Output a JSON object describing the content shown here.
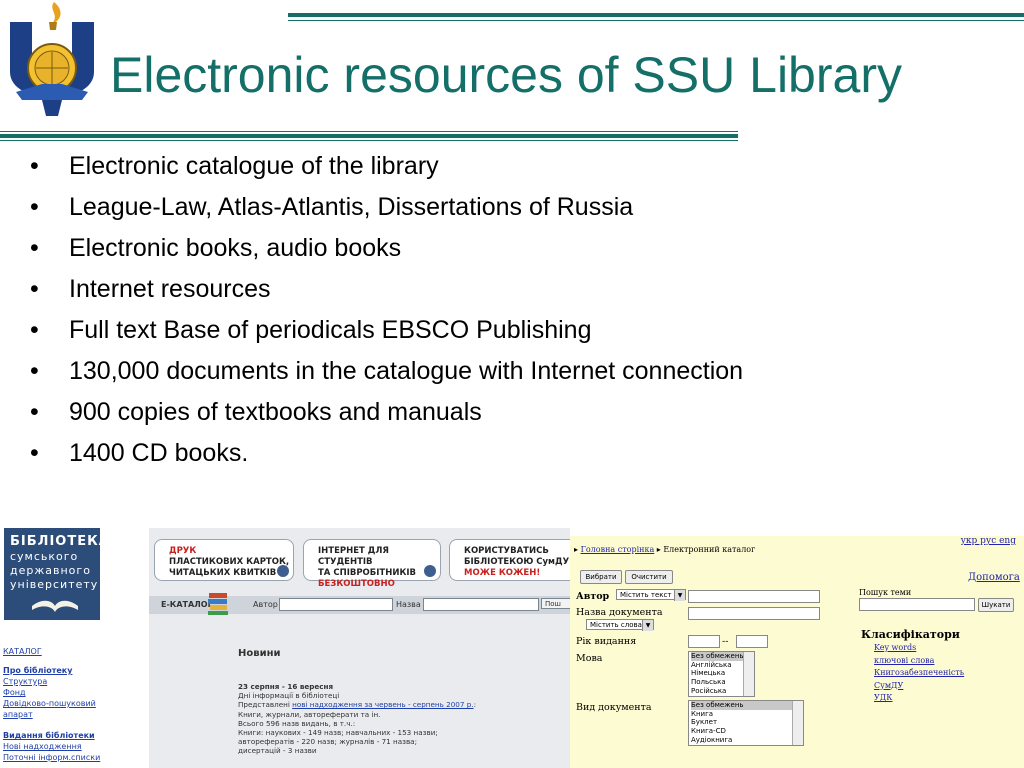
{
  "slide": {
    "title": "Electronic resources of SSU Library",
    "logo_icon": "university-torch-crest-logo",
    "bullets": [
      "Electronic catalogue of the library",
      "League-Law, Atlas-Atlantis, Dissertations of Russia",
      "Electronic books, audio books",
      "Internet resources",
      "Full text Base of periodicals  EBSCO Publishing",
      "130,000 documents in the catalogue with Internet connection",
      "900 copies of textbooks and manuals",
      "1400 CD books."
    ],
    "bullet_glyph": "•",
    "accent_color": "#136f68"
  },
  "library_site": {
    "logo_title": "БІБЛІОТЕКА",
    "logo_subtitle": [
      "сумського",
      "державного",
      "університету"
    ],
    "side_head": "КАТАЛОГ",
    "side_links": [
      "Про бібліотеку",
      "Структура",
      "Фонд",
      "Довідково-пошуковий",
      "апарат"
    ],
    "side_head2": "Видання бібліотеки",
    "side_links2": [
      "Нові надходження",
      "Поточні інформ.списки"
    ],
    "banners": [
      {
        "l1": "ДРУК",
        "l2": "ПЛАСТИКОВИХ КАРТОК,",
        "l3": "ЧИТАЦЬКИХ КВИТКІВ",
        "l4": ""
      },
      {
        "l1": "ІНТЕРНЕТ ДЛЯ СТУДЕНТІВ",
        "l2": "ТА СПІВРОБІТНИКІВ",
        "l3": "",
        "l4": "БЕЗКОШТОВНО"
      },
      {
        "l1": "КОРИСТУВАТИСЬ",
        "l2": "БІБЛІОТЕКОЮ СумДУ",
        "l3": "",
        "l4": "МОЖЕ КОЖЕН!"
      }
    ],
    "ecat_label": "Е-КАТАЛОГ",
    "author_label": "Автор",
    "title_label": "Назва",
    "search_button": "Пош",
    "news_title": "Новини",
    "news_date": "23 серпня - 16 вересня",
    "news_lines": [
      "Дні інформації в бібліотеці",
      "Книги, журнали, автореферати та ін.",
      "Всього 596 назв видань, в т.ч.:",
      "Книги: наукових - 149 назв; навчальних - 153 назви;",
      "авторефератів - 220 назв; журналів - 71 назва;",
      "дисертацій - 3 назви"
    ],
    "news_link_prefix": "Представлені ",
    "news_link": "нові надходження за червень - серпень 2007 р.",
    "news_link_suffix": ":"
  },
  "catalog_site": {
    "lang_links": "укр рус eng",
    "crumb_home": "Головна сторінка",
    "crumb_current": "Електронний каталог",
    "btn_choose": "Вибрати",
    "btn_clear": "Очистити",
    "help": "Допомога",
    "author_label": "Автор",
    "author_select": "Містить текст",
    "docname_label": "Назва документа",
    "docname_select": "Містить слова",
    "year_label": "Рік видання",
    "year_sep": "--",
    "lang_label": "Мова",
    "lang_options": [
      "Без обмежень",
      "Англійська",
      "Німецька",
      "Польська",
      "Російська"
    ],
    "doctype_label": "Вид документа",
    "doctype_options": [
      "Без обмежень",
      "Книга",
      "Буклет",
      "Книга-CD",
      "Аудіокнига"
    ],
    "topic_label": "Пошук теми",
    "topic_button": "Шукати",
    "classifiers_head": "Класифікатори",
    "classifiers": [
      "Key words",
      "ключові слова",
      "Книгозабезпеченість",
      "СумДУ",
      "УДК"
    ]
  }
}
